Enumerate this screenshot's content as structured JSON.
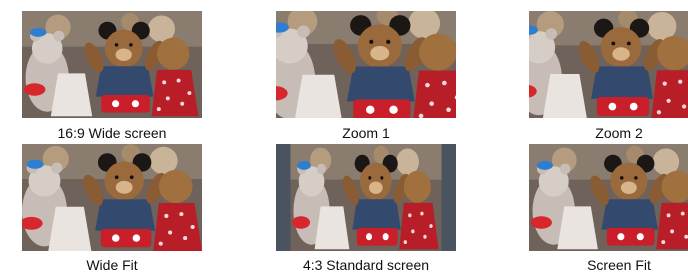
{
  "figure": {
    "modes": [
      {
        "id": "wide",
        "label": "16:9 Wide screen"
      },
      {
        "id": "zoom1",
        "label": "Zoom 1"
      },
      {
        "id": "zoom2",
        "label": "Zoom 2"
      },
      {
        "id": "widefit",
        "label": "Wide Fit"
      },
      {
        "id": "std43",
        "label": "4:3 Standard screen"
      },
      {
        "id": "screenfit",
        "label": "Screen Fit"
      }
    ]
  }
}
